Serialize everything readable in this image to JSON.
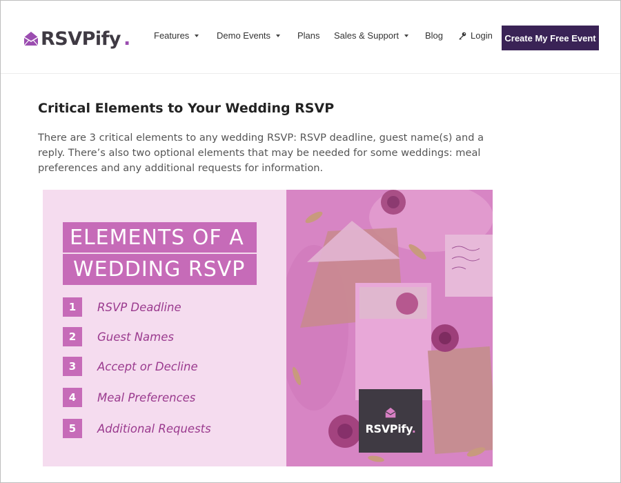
{
  "brand": {
    "name": "RSVPify",
    "dot": ".",
    "accent": "#9b4db0",
    "dark": "#3f3a43"
  },
  "nav": {
    "items": [
      {
        "label": "Features",
        "dropdown": true
      },
      {
        "label": "Demo Events",
        "dropdown": true
      },
      {
        "label": "Plans",
        "dropdown": false
      },
      {
        "label": "Sales & Support",
        "dropdown": true
      },
      {
        "label": "Blog",
        "dropdown": false
      }
    ],
    "login_label": "Login",
    "cta_label": "Create My Free Event",
    "cta_color": "#3a2356"
  },
  "article": {
    "title": "Critical Elements to Your Wedding RSVP",
    "paragraph": "There are 3 critical elements to any wedding RSVP: RSVP deadline, guest name(s) and a reply. There’s also two optional elements that may be needed for some weddings: meal preferences and any additional requests for information."
  },
  "infographic": {
    "banner_line1": "ELEMENTS OF A",
    "banner_line2": "WEDDING RSVP",
    "steps": [
      {
        "num": "1",
        "label": "RSVP Deadline"
      },
      {
        "num": "2",
        "label": "Guest Names"
      },
      {
        "num": "3",
        "label": "Accept or Decline"
      },
      {
        "num": "4",
        "label": "Meal Preferences"
      },
      {
        "num": "5",
        "label": "Additional Requests"
      }
    ],
    "brand_label": "RSVPify",
    "brand_dot": ".",
    "panel_color": "#f5dcef",
    "banner_color": "#c66bb8",
    "step_text_color": "#9a3a8e"
  }
}
